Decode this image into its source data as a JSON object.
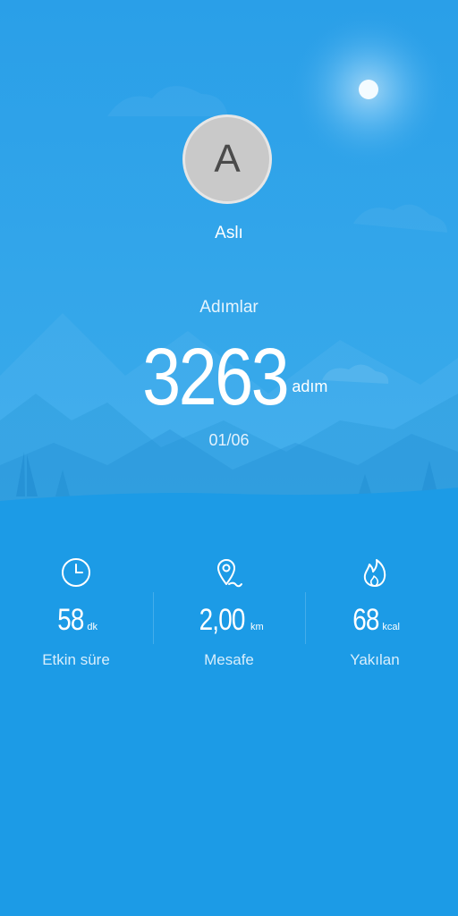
{
  "profile": {
    "avatar_letter": "A",
    "name": "Aslı"
  },
  "steps": {
    "label": "Adımlar",
    "value": "3263",
    "unit": "adım",
    "date": "01/06"
  },
  "stats": [
    {
      "icon": "clock-icon",
      "value": "58",
      "unit": "dk",
      "label": "Etkin süre"
    },
    {
      "icon": "location-pin-icon",
      "value": "2,00",
      "unit": "km",
      "label": "Mesafe"
    },
    {
      "icon": "flame-icon",
      "value": "68",
      "unit": "kcal",
      "label": "Yakılan"
    }
  ],
  "colors": {
    "background": "#1c9be6",
    "hero_top": "#2a9fe8",
    "accent": "#ffffff"
  }
}
